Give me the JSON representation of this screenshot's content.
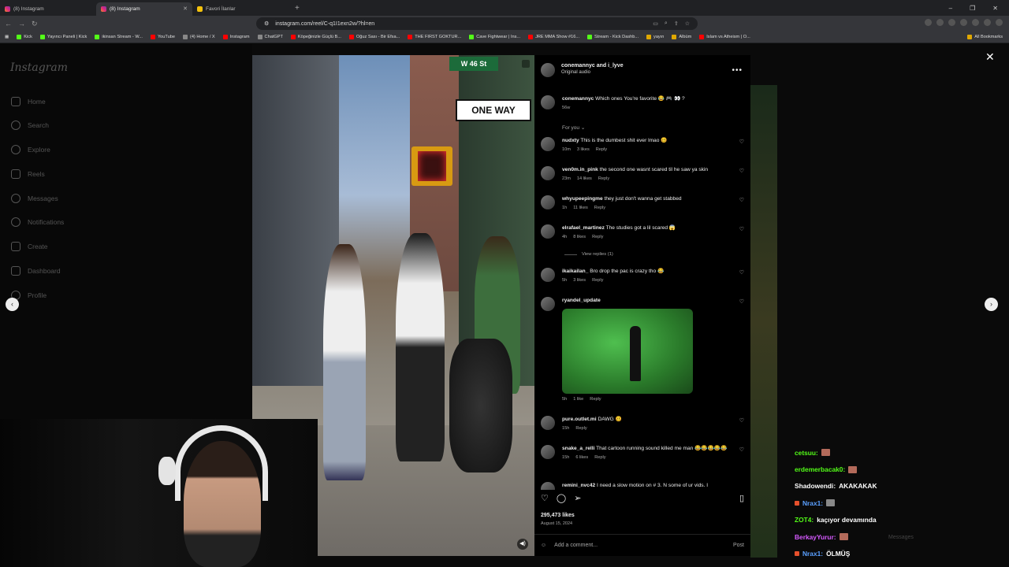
{
  "browser": {
    "tabs": [
      {
        "label": "(8) Instagram",
        "active": false
      },
      {
        "label": "(8) Instagram",
        "active": true
      },
      {
        "label": "Favori İlanlar",
        "active": false
      }
    ],
    "url": "instagram.com/reel/C-q1I1exn2w/?hl=en",
    "bookmarks": [
      "Kick",
      "Yayıncı Paneli | Kick",
      "ikinsan Stream - W...",
      "YouTube",
      "(4) Home / X",
      "Instagram",
      "ChatGPT",
      "Köpeğinizle Güçlü B...",
      "Oğuz Sası - Bir Efsa...",
      "THE FIRST GOKTUR...",
      "Cave Fightwear | Ins...",
      "JRE MMA Show #16...",
      "Stream - Kick Dashb...",
      "yayın",
      "Albüm",
      "Islam vs Atheism | O..."
    ],
    "all_bookmarks": "All Bookmarks"
  },
  "sidebar": {
    "logo": "Instagram",
    "items": [
      "Home",
      "Search",
      "Explore",
      "Reels",
      "Messages",
      "Notifications",
      "Create",
      "Dashboard",
      "Profile"
    ]
  },
  "video": {
    "street_sign": "W 46 St",
    "one_way": "ONE WAY"
  },
  "post": {
    "author": "conemannyc and i_lyve",
    "audio": "Original audio",
    "caption_user": "conemannyc",
    "caption_text": "Which ones You're favorite 😂 🎮 👀 ?",
    "caption_time": "56w",
    "for_you": "For you ⌄",
    "view_replies": "View replies (1)",
    "comments": [
      {
        "user": "nudxty",
        "text": "This is the dumbest shit ever lmao 🥴",
        "time": "10m",
        "likes": "3 likes",
        "reply": "Reply"
      },
      {
        "user": "ven0m.in_pink",
        "text": "the second one wasnt scared til he saw ya skin",
        "time": "23m",
        "likes": "14 likes",
        "reply": "Reply"
      },
      {
        "user": "whyupeepingme",
        "text": "they just don't wanna get stabbed",
        "time": "1h",
        "likes": "11 likes",
        "reply": "Reply"
      },
      {
        "user": "elrafael_martinez",
        "text": "The studies got a lil scared 😱",
        "time": "4h",
        "likes": "8 likes",
        "reply": "Reply"
      },
      {
        "user": "ikaikailan_",
        "text": "Bro drop the pac is crazy tho 😂",
        "time": "5h",
        "likes": "3 likes",
        "reply": "Reply"
      },
      {
        "user": "ryandel_update",
        "text": "",
        "time": "5h",
        "likes": "1 like",
        "reply": "Reply"
      },
      {
        "user": "pure.outlet.mi",
        "text": "DAWG 🥴",
        "time": "15h",
        "likes": "",
        "reply": "Reply"
      },
      {
        "user": "snake_a_relli",
        "text": "That cartoon running sound killed me man 😂😂😂😂😂",
        "time": "15h",
        "likes": "6 likes",
        "reply": "Reply"
      },
      {
        "user": "remini_nvc42",
        "text": "I need a slow motion on # 3. N some of ur vids. I",
        "time": "",
        "likes": "",
        "reply": ""
      }
    ],
    "likes": "295,473 likes",
    "date": "August 15, 2024",
    "add_comment_placeholder": "Add a comment...",
    "post_label": "Post"
  },
  "chat": [
    {
      "user": "cetsuu:",
      "msg": "",
      "color": "#53fc18",
      "emote": true
    },
    {
      "user": "erdemerbacak0:",
      "msg": "",
      "color": "#53fc18",
      "emote": true
    },
    {
      "user": "Shadowendi:",
      "msg": "AKAKAKAK",
      "color": "#ffffff",
      "emote": false
    },
    {
      "user": "Nrax1:",
      "msg": "",
      "color": "#5aa0ff",
      "emote": true,
      "badge": true
    },
    {
      "user": "ZOT4:",
      "msg": "kaçıyor devamında",
      "color": "#53fc18",
      "emote": false
    },
    {
      "user": "BerkayYurur:",
      "msg": "",
      "color": "#d65aff",
      "emote": true
    },
    {
      "user": "Nrax1:",
      "msg": "ÖLMÜŞ",
      "color": "#5aa0ff",
      "emote": false,
      "badge": true
    }
  ],
  "faded_messages": "Messages"
}
